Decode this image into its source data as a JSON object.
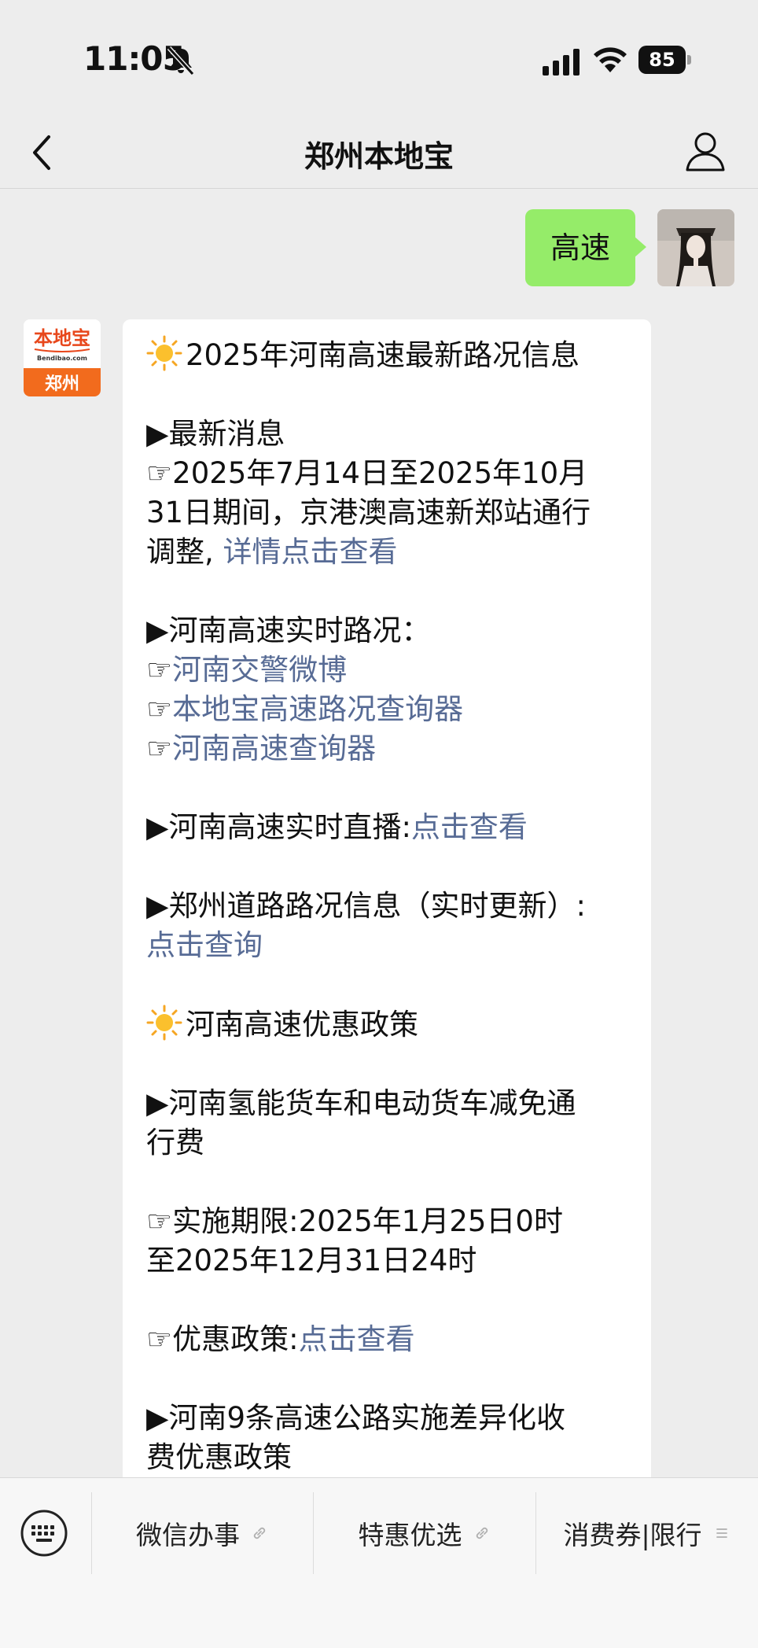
{
  "status_bar": {
    "time": "11:05",
    "battery": "85"
  },
  "nav": {
    "title": "郑州本地宝"
  },
  "user_message": {
    "text": "高速"
  },
  "bot_message": {
    "logo_top": "本地宝",
    "logo_mid": "Bendibao.com",
    "logo_bottom": "郑州",
    "title": "2025年河南高速最新路况信息",
    "latest_heading": "▶最新消息",
    "latest_line1": "☞2025年7月14日至2025年10月",
    "latest_line2": "31日期间，京港澳高速新郑站通行",
    "latest_line3": "调整,",
    "latest_link": "详情点击查看",
    "realtime_heading": "▶河南高速实时路况：",
    "realtime_prefix": "☞",
    "realtime_links": [
      "河南交警微博",
      "本地宝高速路况查询器",
      "河南高速查询器"
    ],
    "live_label": "▶河南高速实时直播:",
    "live_link": "点击查看",
    "zz_label": "▶郑州道路路况信息（实时更新）:",
    "zz_link": "点击查询",
    "policy_title": "河南高速优惠政策",
    "hydrogen_line1": "▶河南氢能货车和电动货车减免通",
    "hydrogen_line2": "行费",
    "period_line1": "☞实施期限:2025年1月25日0时",
    "period_line2": "至2025年12月31日24时",
    "policy_label": "☞优惠政策:",
    "policy_link": "点击查看",
    "nine_line1": "▶河南9条高速公路实施差异化收",
    "nine_line2": "费优惠政策"
  },
  "bottom_menu": {
    "items": [
      {
        "label": "微信办事",
        "icon": "link-icon"
      },
      {
        "label": "特惠优选",
        "icon": "link-icon"
      },
      {
        "label": "消费券|限行",
        "icon": "menu-list-icon"
      }
    ]
  },
  "colors": {
    "background": "#ededed",
    "user_bubble": "#95ec69",
    "link": "#576b95",
    "logo_orange": "#f26b1d"
  }
}
